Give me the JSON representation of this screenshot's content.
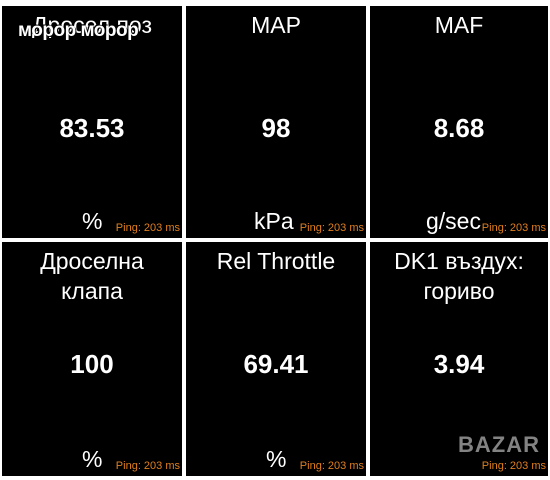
{
  "overlay_text": "мороp морор",
  "watermark": "BAZAR",
  "tiles": [
    {
      "title": "Дросел поз",
      "value": "83.53",
      "unit": "%",
      "ping": "Ping: 203 ms"
    },
    {
      "title": "MAP",
      "value": "98",
      "unit": "kPa",
      "ping": "Ping: 203 ms"
    },
    {
      "title": "MAF",
      "value": "8.68",
      "unit": "g/sec",
      "ping": "Ping: 203 ms"
    },
    {
      "title": "Дроселна\nклапа",
      "value": "100",
      "unit": "%",
      "ping": "Ping: 203 ms"
    },
    {
      "title": "Rel Throttle",
      "value": "69.41",
      "unit": "%",
      "ping": "Ping: 203 ms"
    },
    {
      "title": "DK1 въздух:\nгориво",
      "value": "3.94",
      "unit": "",
      "ping": "Ping: 203 ms"
    }
  ]
}
